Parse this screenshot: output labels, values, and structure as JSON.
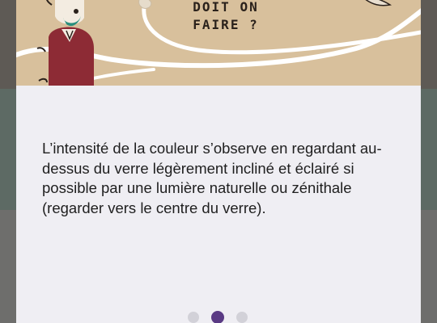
{
  "illustration": {
    "line1": "DOIT ON",
    "line2": "FAIRE ?"
  },
  "content": {
    "text": "L’intensité de la couleur s’observe en regardant au-dessus du verre légèrement incliné et éclairé si possible par une lumière naturelle ou zénithale (regarder vers le centre du verre)."
  },
  "pagination": {
    "count": 3,
    "active_index": 1
  },
  "colors": {
    "accent": "#5a3a84",
    "card": "#efeef3",
    "illustration_bg": "#d8c09c"
  }
}
